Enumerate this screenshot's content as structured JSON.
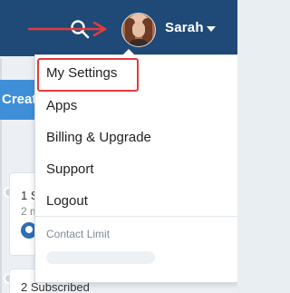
{
  "user": {
    "name": "Sarah"
  },
  "header": {
    "search_icon": "search-icon",
    "caret_icon": "caret-down-icon"
  },
  "background": {
    "create_label": "Creat",
    "items": [
      {
        "title": "1 S",
        "subtitle": "2 m"
      },
      {
        "title": "2 Subscribed"
      }
    ]
  },
  "menu": {
    "items": [
      {
        "label": "My Settings",
        "highlighted": true
      },
      {
        "label": "Apps"
      },
      {
        "label": "Billing & Upgrade"
      },
      {
        "label": "Support"
      },
      {
        "label": "Logout"
      }
    ],
    "contact_limit_label": "Contact Limit",
    "contact_limit_fraction": 0.0
  },
  "colors": {
    "topbar": "#1f4a78",
    "highlight": "#e53b3b",
    "accent": "#2e9fd8"
  }
}
